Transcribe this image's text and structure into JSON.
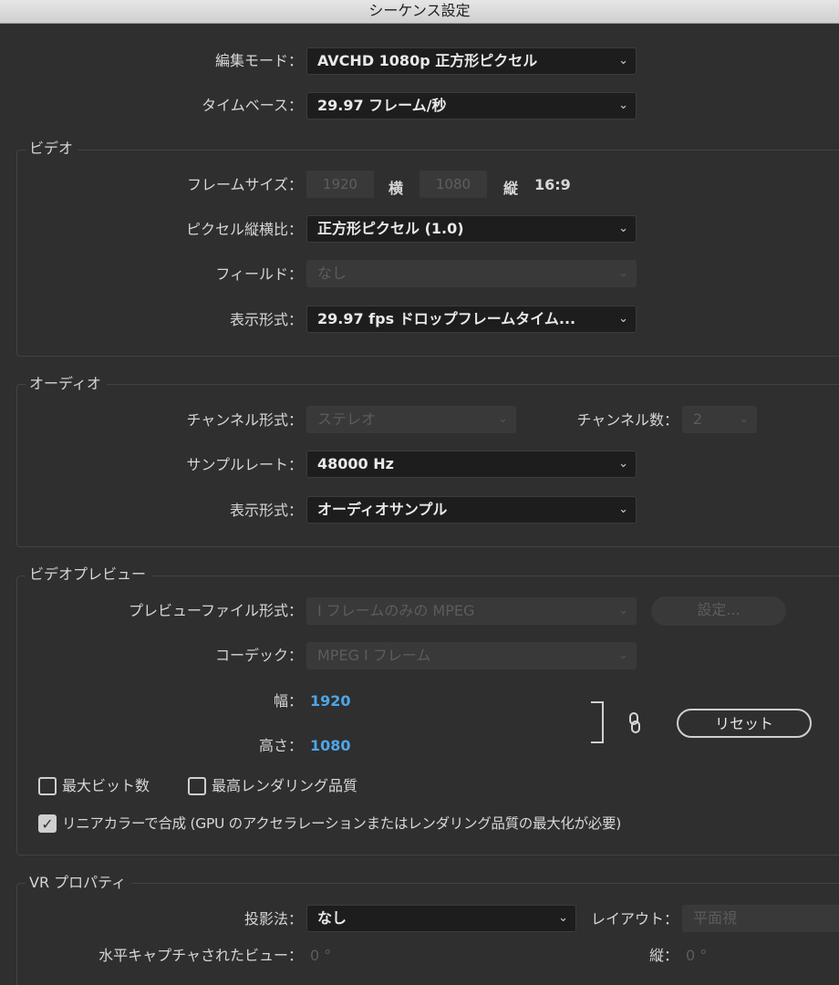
{
  "window": {
    "title": "シーケンス設定"
  },
  "general": {
    "edit_mode_label": "編集モード：",
    "edit_mode_value": "AVCHD 1080p 正方形ピクセル",
    "timebase_label": "タイムベース：",
    "timebase_value": "29.97 フレーム/秒"
  },
  "video": {
    "group_title": "ビデオ",
    "frame_size_label": "フレームサイズ：",
    "frame_width": "1920",
    "horizontal_label": "横",
    "frame_height": "1080",
    "vertical_label": "縦",
    "aspect": "16:9",
    "pixel_aspect_label": "ピクセル縦横比：",
    "pixel_aspect_value": "正方形ピクセル (1.0)",
    "fields_label": "フィールド：",
    "fields_value": "なし",
    "display_format_label": "表示形式：",
    "display_format_value": "29.97 fps ドロップフレームタイム..."
  },
  "audio": {
    "group_title": "オーディオ",
    "channel_format_label": "チャンネル形式：",
    "channel_format_value": "ステレオ",
    "channel_count_label": "チャンネル数：",
    "channel_count_value": "2",
    "sample_rate_label": "サンプルレート：",
    "sample_rate_value": "48000 Hz",
    "display_format_label": "表示形式：",
    "display_format_value": "オーディオサンプル"
  },
  "video_preview": {
    "group_title": "ビデオプレビュー",
    "file_format_label": "プレビューファイル形式：",
    "file_format_value": "I フレームのみの MPEG",
    "settings_button": "設定...",
    "codec_label": "コーデック：",
    "codec_value": "MPEG I フレーム",
    "width_label": "幅：",
    "width_value": "1920",
    "height_label": "高さ：",
    "height_value": "1080",
    "reset_button": "リセット"
  },
  "options": {
    "max_bit_depth": {
      "label": "最大ビット数",
      "checked": false
    },
    "max_render_quality": {
      "label": "最高レンダリング品質",
      "checked": false
    },
    "linear_color": {
      "label": "リニアカラーで合成 (GPU のアクセラレーションまたはレンダリング品質の最大化が必要)",
      "checked": true
    }
  },
  "vr": {
    "group_title": "VR プロパティ",
    "projection_label": "投影法：",
    "projection_value": "なし",
    "layout_label": "レイアウト：",
    "layout_value": "平面視",
    "h_view_label": "水平キャプチャされたビュー：",
    "h_view_value": "0 °",
    "v_view_label": "縦：",
    "v_view_value": "0 °"
  },
  "icons": {
    "dropdown": "chevron-down-icon",
    "link": "link-chain-icon",
    "check": "checkmark-icon"
  }
}
